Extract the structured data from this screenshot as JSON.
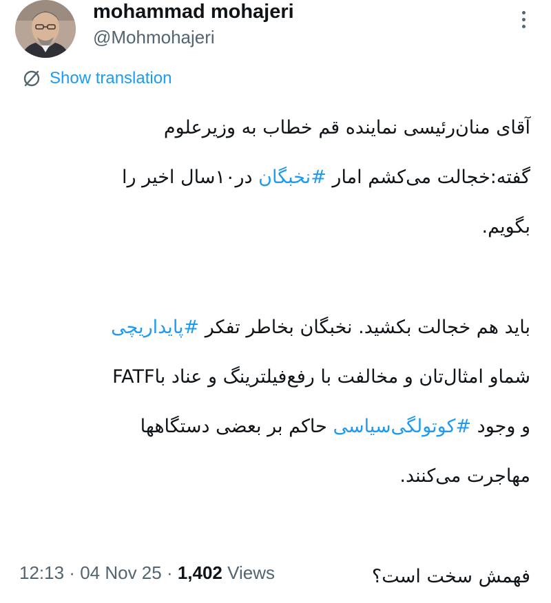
{
  "author": {
    "display_name": "mohammad mohajeri",
    "handle": "@Mohmohajeri"
  },
  "translate_label": "Show translation",
  "tweet": {
    "line1": "آقای منان‌رئیسی نماینده قم خطاب به وزیرعلوم",
    "line2": {
      "before": "گفته:خجالت می‌کشم امار ",
      "hashtag": "#نخبگان",
      "after": " در۱۰سال اخیر را"
    },
    "line3": "بگویم.",
    "line4": {
      "before": "باید هم خجالت بکشید. نخبگان بخاطر تفکر ",
      "hashtag": "#پایداریچی"
    },
    "line5": "شماو امثال‌تان و مخالفت با رفع‌فیلترینگ و عناد باFATF",
    "line6": {
      "before": "و وجود ",
      "hashtag": "#کوتولگی‌سیاسی",
      "after": " حاکم بر بعضی  دستگاهها"
    },
    "line7": "مهاجرت می‌کنند.",
    "line8": "فهمش سخت است؟"
  },
  "meta": {
    "time": "12:13",
    "sep1": " · ",
    "date": "04 Nov 25",
    "sep2": " · ",
    "views_count": "1,402",
    "views_label": " Views"
  },
  "colors": {
    "accent": "#1d9bf0",
    "text": "#0f1419",
    "secondary": "#536471"
  },
  "icons": {
    "more": "more-dots-icon",
    "translate": "globe-slash-icon"
  }
}
